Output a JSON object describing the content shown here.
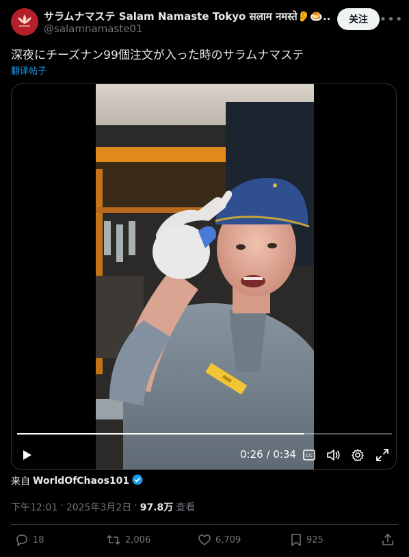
{
  "author": {
    "name": "サラムナマステ Salam Namaste Tokyo सलाम नमस्ते👂🍮...",
    "handle": "@salamnamaste01"
  },
  "follow_label": "关注",
  "more_label": "•••",
  "tweet": {
    "text": "深夜にチーズナン99個注文が入った時のサラムナマステ",
    "translate_label": "翻译帖子"
  },
  "video": {
    "time_label": "0:26 / 0:34",
    "progress": 0.765
  },
  "source": {
    "prefix": "来自",
    "name": "WorldOfChaos101"
  },
  "meta": {
    "time": "下午12:01",
    "sep1": "·",
    "date": "2025年3月2日",
    "sep2": "·",
    "views": "97.8万",
    "views_label": "查看"
  },
  "actions": {
    "replies": "18",
    "reposts": "2,006",
    "likes": "6,709",
    "bookmarks": "925"
  },
  "colors": {
    "accent": "#1d9bf0",
    "avatar": "#b51f2c"
  }
}
